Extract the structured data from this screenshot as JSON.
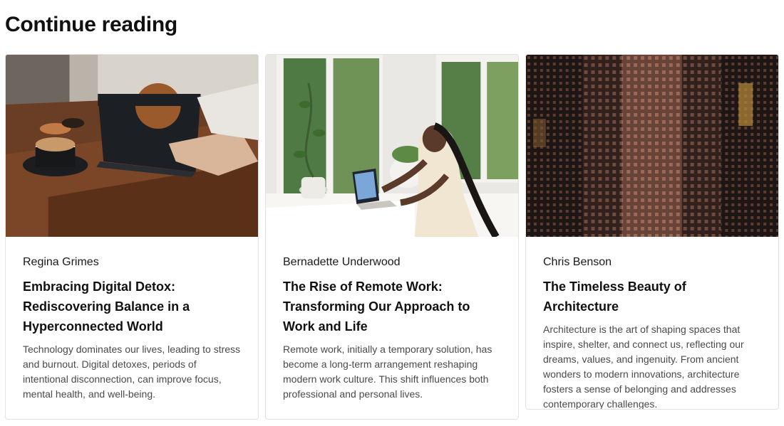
{
  "section": {
    "title": "Continue reading"
  },
  "cards": [
    {
      "image_alt": "Tablet and coffee on a wooden table",
      "author": "Regina Grimes",
      "title": "Embracing Digital Detox: Rediscovering Balance in a Hyperconnected World",
      "excerpt": "Technology dominates our lives, leading to stress and burnout. Digital detoxes, periods of intentional disconnection, can improve focus, mental health, and well-being."
    },
    {
      "image_alt": "Woman working on a laptop by a window",
      "author": "Bernadette Underwood",
      "title": "The Rise of Remote Work: Transforming Our Approach to Work and Life",
      "excerpt": "Remote work, initially a temporary solution, has become a long-term arrangement reshaping modern work culture. This shift influences both professional and personal lives."
    },
    {
      "image_alt": "Dense apartment building facade",
      "author": "Chris Benson",
      "title": "The Timeless Beauty of Architecture",
      "excerpt": "Architecture is the art of shaping spaces that inspire, shelter, and connect us, reflecting our dreams, values, and ingenuity. From ancient wonders to modern innovations, architecture fosters a sense of belonging and addresses contemporary challenges."
    }
  ]
}
